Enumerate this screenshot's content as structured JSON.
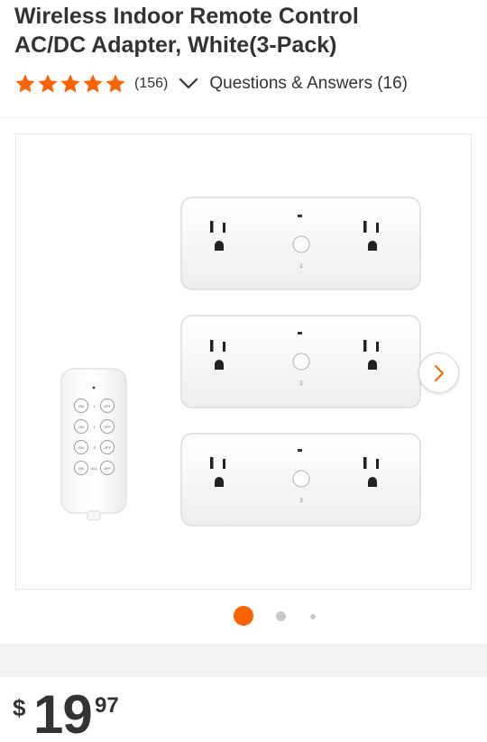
{
  "product": {
    "title": "Wireless Indoor Remote Control\nAC/DC Adapter, White(3-Pack)",
    "rating": {
      "stars": 5,
      "count_label": "(156)"
    },
    "qa_label": "Questions & Answers (16)"
  },
  "gallery": {
    "current_index": 1,
    "total_images": 3,
    "outlet_numbers": [
      "1",
      "2",
      "3"
    ],
    "remote_rows": [
      {
        "on": "ON",
        "num": "1",
        "off": "OFF"
      },
      {
        "on": "ON",
        "num": "2",
        "off": "OFF"
      },
      {
        "on": "ON",
        "num": "3",
        "off": "OFF"
      },
      {
        "on": "ON",
        "num": "ALL",
        "off": "OFF"
      }
    ]
  },
  "price": {
    "currency": "$",
    "dollars": "19",
    "cents": "97"
  },
  "colors": {
    "accent": "#f96302",
    "star": "#f96302",
    "text": "#333333",
    "band": "#f2f2f2"
  },
  "icons": {
    "star": "star-icon",
    "expand": "chevron-down-icon",
    "next": "chevron-right-icon"
  }
}
